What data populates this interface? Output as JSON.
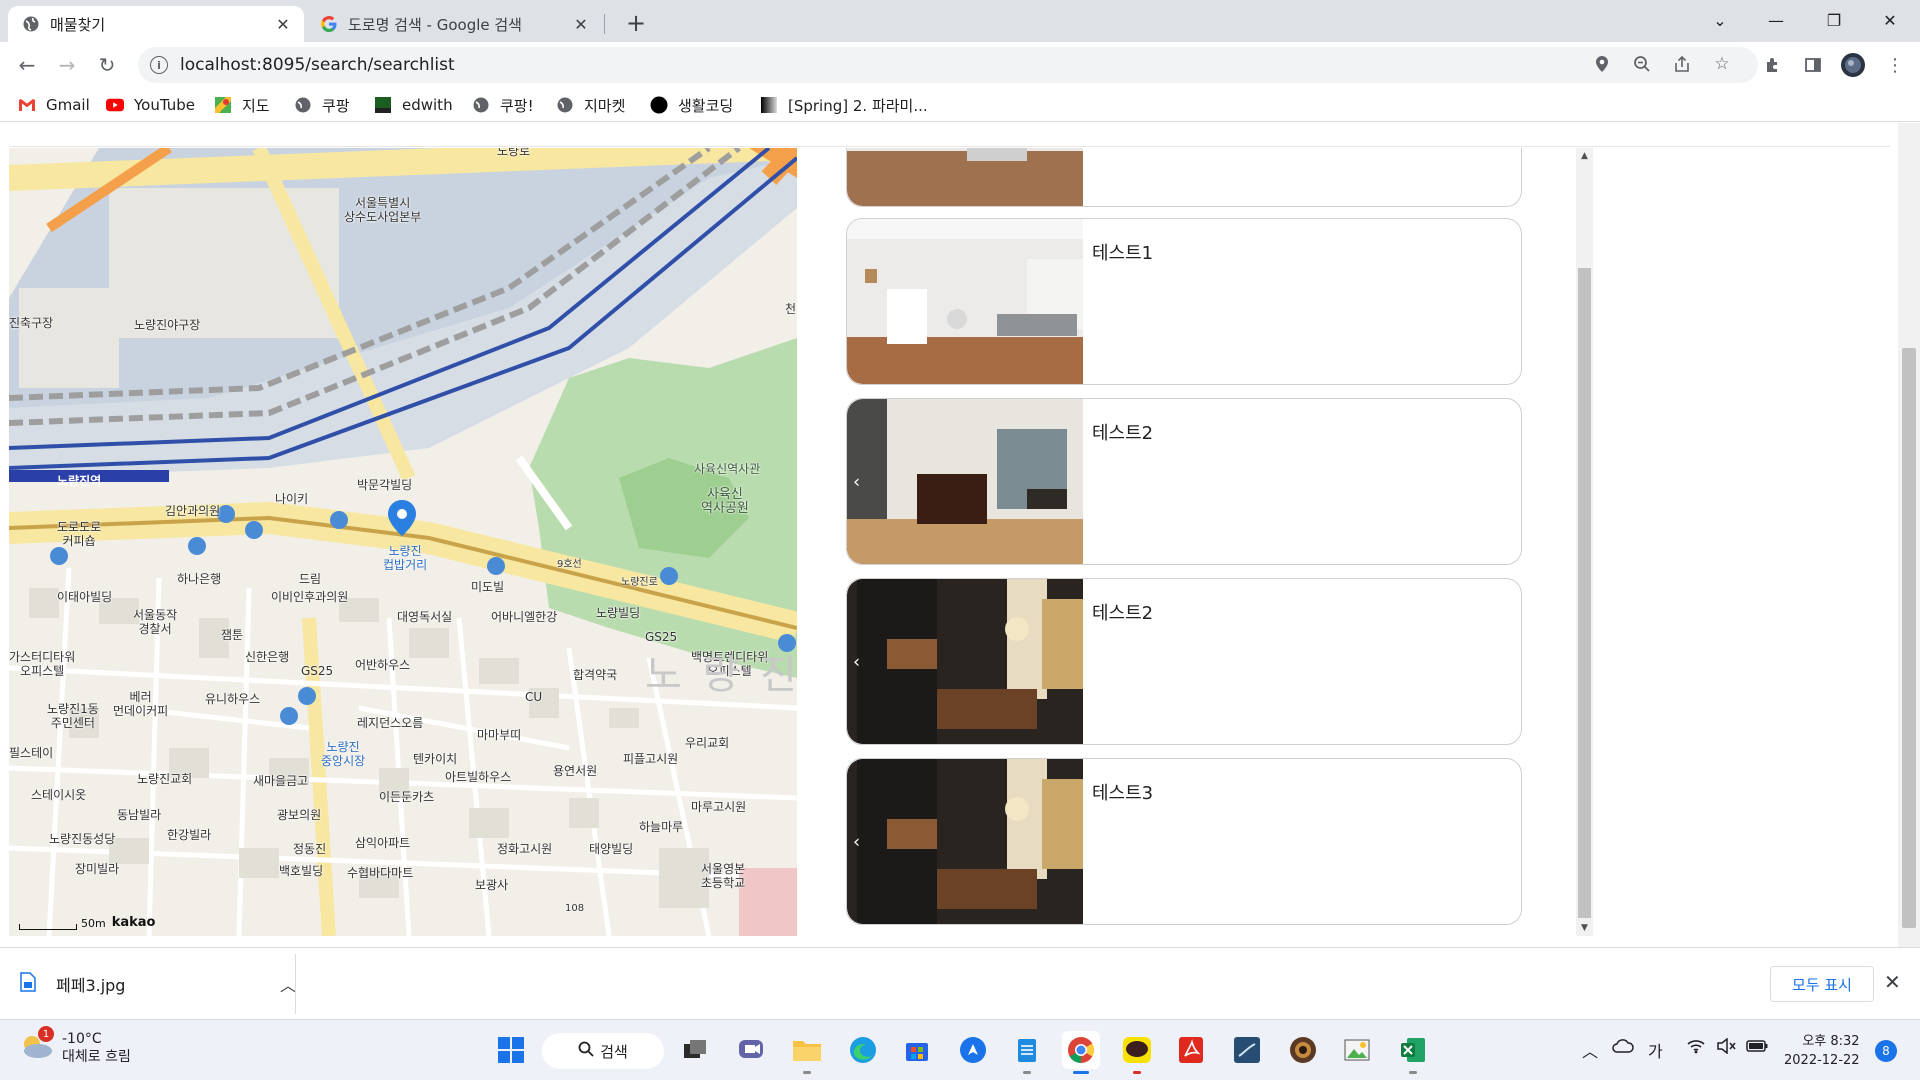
{
  "browser": {
    "tabs": [
      {
        "title": "매물찾기",
        "active": true
      },
      {
        "title": "도로명 검색 - Google 검색",
        "active": false
      }
    ],
    "url": "localhost:8095/search/searchlist",
    "bookmarks": [
      "Gmail",
      "YouTube",
      "지도",
      "쿠팡",
      "edwith",
      "쿠팡!",
      "지마켓",
      "생활코딩",
      "[Spring] 2. 파라미..."
    ]
  },
  "map": {
    "labels": [
      {
        "text": "노량로"
      },
      {
        "text": "서울특별시\n상수도사업본부"
      },
      {
        "text": "진축구장"
      },
      {
        "text": "노량진야구장"
      },
      {
        "text": "천"
      },
      {
        "text": "사육신역사관"
      },
      {
        "text": "사육신\n역사공원"
      },
      {
        "text": "박문각빌딩"
      },
      {
        "text": "노량진역"
      },
      {
        "text": "나이키"
      },
      {
        "text": "김안과의원"
      },
      {
        "text": "도로도로\n커피숍"
      },
      {
        "text": "노량진\n컵밥거리"
      },
      {
        "text": "9호선"
      },
      {
        "text": "노량진로"
      },
      {
        "text": "하나은행"
      },
      {
        "text": "드림"
      },
      {
        "text": "이비인후과의원"
      },
      {
        "text": "미도빌"
      },
      {
        "text": "이태아빌딩"
      },
      {
        "text": "서울동작\n경찰서"
      },
      {
        "text": "대영독서실"
      },
      {
        "text": "어바니엘한강"
      },
      {
        "text": "노량빌딩"
      },
      {
        "text": "잼툰"
      },
      {
        "text": "GS25"
      },
      {
        "text": "가스터디타워\n오피스텔"
      },
      {
        "text": "신한은행"
      },
      {
        "text": "어반하우스"
      },
      {
        "text": "합격약국"
      },
      {
        "text": "백명트렌디타워\n오피스텔"
      },
      {
        "text": "GS25"
      },
      {
        "text": "CU"
      },
      {
        "text": "노 량 진"
      },
      {
        "text": "노량진1동\n주민센터"
      },
      {
        "text": "베러\n먼데이커피"
      },
      {
        "text": "유니하우스"
      },
      {
        "text": "레지던스오름"
      },
      {
        "text": "마마부띠"
      },
      {
        "text": "우리교회"
      },
      {
        "text": "노량진\n중앙시장"
      },
      {
        "text": "텐카이치"
      },
      {
        "text": "용연서원"
      },
      {
        "text": "피플고시원"
      },
      {
        "text": "필스테이"
      },
      {
        "text": "노량진교회"
      },
      {
        "text": "새마을금고"
      },
      {
        "text": "아트빌하우스"
      },
      {
        "text": "스테이시옷"
      },
      {
        "text": "이든둔카츠"
      },
      {
        "text": "마루고시원"
      },
      {
        "text": "동남빌라"
      },
      {
        "text": "광보의원"
      },
      {
        "text": "하늘마루"
      },
      {
        "text": "노량진동성당"
      },
      {
        "text": "한강빌라"
      },
      {
        "text": "삼익아파트"
      },
      {
        "text": "정동진"
      },
      {
        "text": "정화고시원"
      },
      {
        "text": "태양빌딩"
      },
      {
        "text": "장미빌라"
      },
      {
        "text": "백호빌딩"
      },
      {
        "text": "수협바다마트"
      },
      {
        "text": "보광사"
      },
      {
        "text": "서울영본\n초등학교"
      },
      {
        "text": "108"
      }
    ],
    "scale_label": "50m",
    "attribution": "kakao"
  },
  "listings": [
    {
      "name": ""
    },
    {
      "name": "테스트1"
    },
    {
      "name": "테스트2"
    },
    {
      "name": "테스트2"
    },
    {
      "name": "테스트3"
    }
  ],
  "download": {
    "file_name": "페페3.jpg",
    "show_all_label": "모두 표시"
  },
  "taskbar": {
    "weather_temp": "-10°C",
    "weather_desc": "대체로 흐림",
    "weather_badge": "1",
    "search_label": "검색",
    "ime_label": "가",
    "clock_time": "오후 8:32",
    "clock_date": "2022-12-22",
    "notification_count": "8"
  }
}
